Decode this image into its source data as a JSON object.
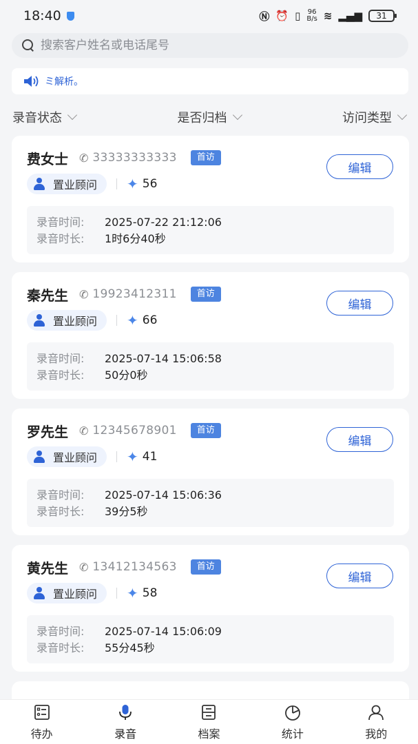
{
  "status_bar": {
    "time": "18:40",
    "network_speed": "96\nB/s",
    "battery": "31"
  },
  "search": {
    "placeholder": "搜索客户姓名或电话尾号"
  },
  "notice": {
    "text": "ミ解析。"
  },
  "filters": [
    {
      "label": "录音状态"
    },
    {
      "label": "是否归档"
    },
    {
      "label": "访问类型"
    }
  ],
  "labels": {
    "record_time": "录音时间:",
    "record_duration": "录音时长:",
    "edit": "编辑"
  },
  "cards": [
    {
      "name": "费女士",
      "phone": "33333333333",
      "tag": "首访",
      "role": "置业顾问",
      "score": "56",
      "record_time": "2025-07-22 21:12:06",
      "duration": "1时6分40秒"
    },
    {
      "name": "秦先生",
      "phone": "19923412311",
      "tag": "首访",
      "role": "置业顾问",
      "score": "66",
      "record_time": "2025-07-14 15:06:58",
      "duration": "50分0秒"
    },
    {
      "name": "罗先生",
      "phone": "12345678901",
      "tag": "首访",
      "role": "置业顾问",
      "score": "41",
      "record_time": "2025-07-14 15:06:36",
      "duration": "39分5秒"
    },
    {
      "name": "黄先生",
      "phone": "13412134563",
      "tag": "首访",
      "role": "置业顾问",
      "score": "58",
      "record_time": "2025-07-14 15:06:09",
      "duration": "55分45秒"
    }
  ],
  "tabs": [
    {
      "label": "待办",
      "icon": "todo-icon"
    },
    {
      "label": "录音",
      "icon": "microphone-icon"
    },
    {
      "label": "档案",
      "icon": "archive-icon"
    },
    {
      "label": "统计",
      "icon": "pie-chart-icon"
    },
    {
      "label": "我的",
      "icon": "user-icon"
    }
  ],
  "colors": {
    "accent": "#2e63d6",
    "tag_bg": "#4d84e0",
    "page_bg": "#f4f5f7"
  }
}
